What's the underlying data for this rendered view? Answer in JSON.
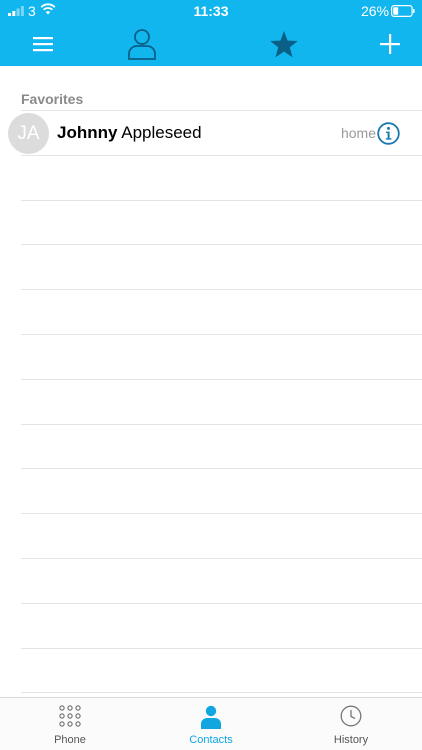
{
  "status_bar": {
    "carrier": "3",
    "time": "11:33",
    "battery": "26%"
  },
  "nav_bar": {
    "accent_color": "#12b6ef",
    "menu_icon": "hamburger-menu-icon",
    "contacts_icon": "person-outline-icon",
    "favorites_icon": "star-icon",
    "add_icon": "plus-icon"
  },
  "favorites": {
    "header": "Favorites",
    "contacts": [
      {
        "initials": "JA",
        "first_name": "Johnny",
        "last_name": "Appleseed",
        "label": "home"
      }
    ]
  },
  "tab_bar": {
    "tabs": [
      {
        "label": "Phone",
        "icon": "dialpad-icon",
        "active": false
      },
      {
        "label": "Contacts",
        "icon": "person-icon",
        "active": true
      },
      {
        "label": "History",
        "icon": "clock-icon",
        "active": false
      }
    ]
  }
}
